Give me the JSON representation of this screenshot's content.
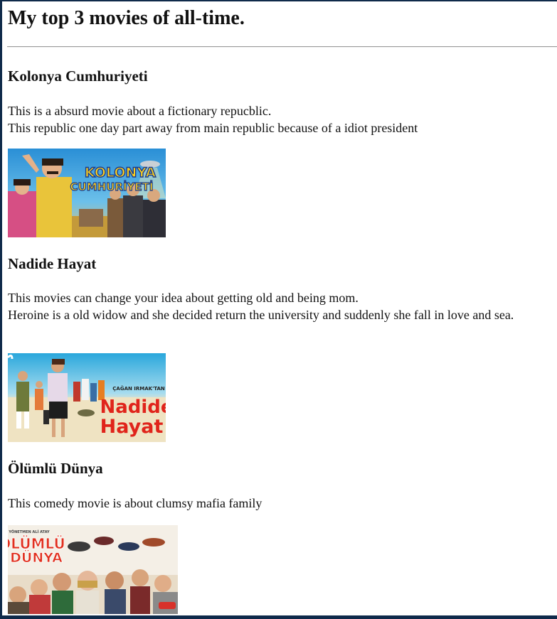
{
  "page": {
    "title": "My top 3 movies of all-time."
  },
  "movies": [
    {
      "name": "Kolonya Cumhuriyeti",
      "description_lines": [
        "This is a absurd movie about a fictionary repucblic.",
        "This republic one day part away from main republic because of a idiot president"
      ],
      "poster_text": [
        "KOLONYA",
        "CUMHURİYETİ"
      ],
      "poster_icon": "kolonya-cumhuriyeti-poster"
    },
    {
      "name": "Nadide Hayat",
      "description_lines": [
        "This movies can change your idea about getting old and being mom.",
        "Heroine is a old widow and she decided return the university and suddenly she fall in love and sea."
      ],
      "poster_text": [
        "ÇAĞAN IRMAK'TAN",
        "Nadide",
        "Hayat"
      ],
      "poster_icon": "nadide-hayat-poster"
    },
    {
      "name": "Ölümlü Dünya",
      "description_lines": [
        "This comedy movie is about clumsy mafia family"
      ],
      "poster_text": [
        "YÖNETMEN ALİ ATAY",
        "ÖLÜMLÜ",
        "DÜNYA"
      ],
      "poster_icon": "olumlu-dunya-poster"
    }
  ],
  "colors": {
    "frame": "#0f2a4a",
    "text": "#111111",
    "rule": "#9a9a9a"
  }
}
